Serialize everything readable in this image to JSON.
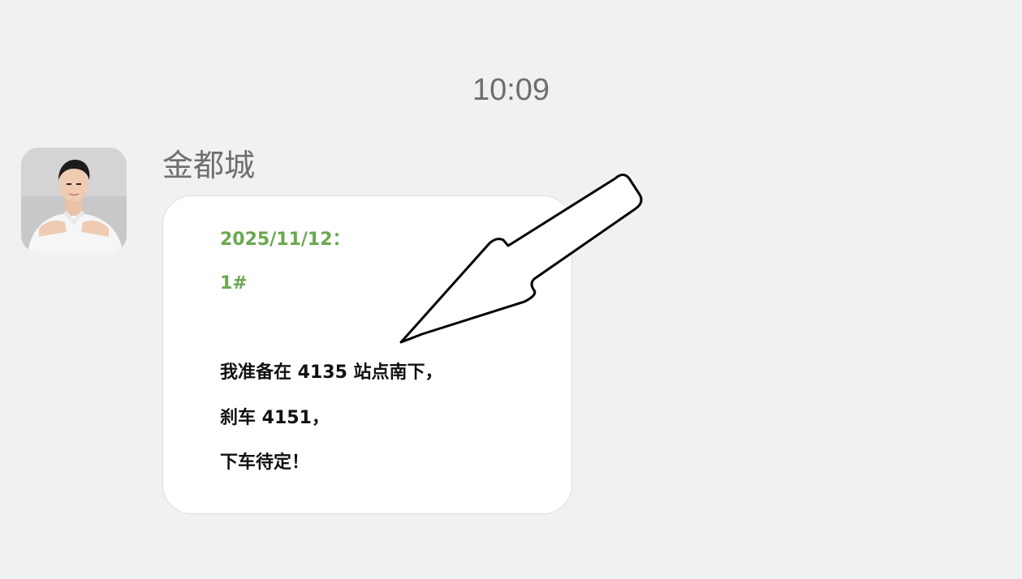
{
  "chat": {
    "timestamp": "10:09",
    "message": {
      "sender_name": "金都城",
      "avatar_icon": "person-photo-avatar",
      "card": {
        "date_line": "2025/11/12：",
        "number_line": "1#",
        "lines": [
          "我准备在 4135 站点南下，",
          "刹车 4151，",
          "下车待定！"
        ],
        "accent_color": "#6aa84f",
        "text_color": "#111111"
      }
    },
    "annotation_icon": "arrow-pointer-icon"
  }
}
